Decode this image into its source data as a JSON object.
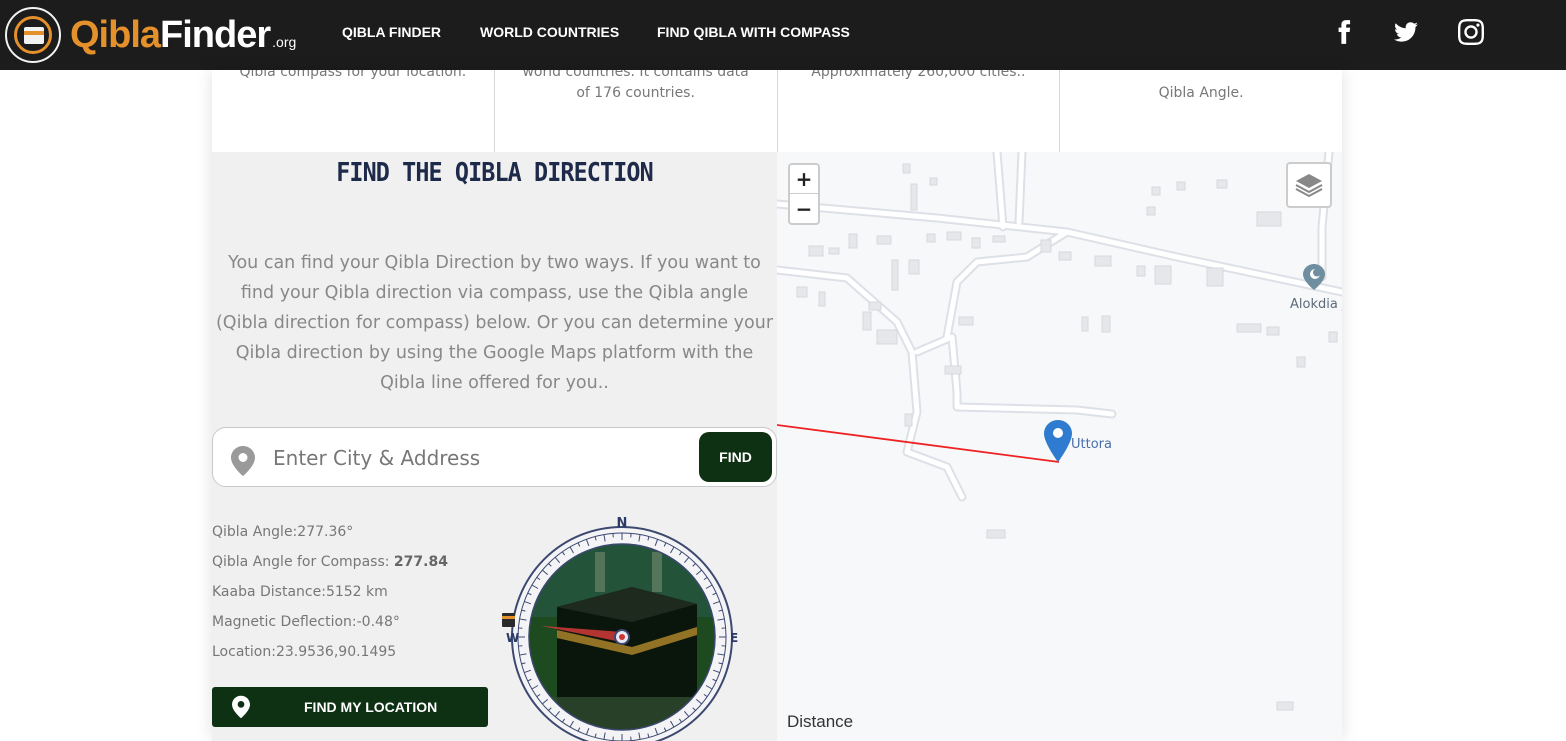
{
  "header": {
    "logo": {
      "primary": "Qibla",
      "secondary": "Finder",
      "suffix": ".org"
    },
    "nav": [
      "QIBLA FINDER",
      "WORLD COUNTRIES",
      "FIND QIBLA WITH COMPASS"
    ],
    "social_icons": [
      "facebook-icon",
      "twitter-icon",
      "instagram-icon"
    ]
  },
  "features": [
    {
      "line1": "Qibla compass for your location.",
      "line2": ""
    },
    {
      "line1": "world countries. It contains data",
      "line2": "of 176 countries."
    },
    {
      "line1": "Approximately 260,000 cities..",
      "line2": ""
    },
    {
      "line1": "",
      "line2": "Qibla Angle."
    }
  ],
  "finder": {
    "title": "FIND THE QIBLA DIRECTION",
    "intro": "You can find your Qibla Direction by two ways. If you want to find your Qibla direction via compass, use the Qibla angle (Qibla direction for compass) below. Or you can determine your Qibla direction by using the Google Maps platform with the Qibla line offered for you..",
    "search_placeholder": "Enter City & Address",
    "find_label": "FIND",
    "info": {
      "angle_label": "Qibla Angle:",
      "angle_value": "277.36°",
      "compass_label": "Qibla Angle for Compass: ",
      "compass_value": "277.84",
      "distance_label": "Kaaba Distance:",
      "distance_value": "5152 km",
      "deflection_label": "Magnetic Deflection:",
      "deflection_value": "-0.48°",
      "location_label": "Location:",
      "location_value": "23.9536,90.1495"
    },
    "locate_label": "FIND MY LOCATION",
    "compass": {
      "n": "N",
      "w": "W",
      "e": "E",
      "needle_angle": 277.84
    }
  },
  "map": {
    "zoom_in": "+",
    "zoom_out": "−",
    "marker_label": "Uttora",
    "poi_label": "Alokdia j",
    "distance_label": "Distance",
    "qibla_line_color": "#ee2222"
  },
  "colors": {
    "accent": "#e5912b",
    "dark_green": "#0f3113",
    "title": "#1e2a4a"
  }
}
